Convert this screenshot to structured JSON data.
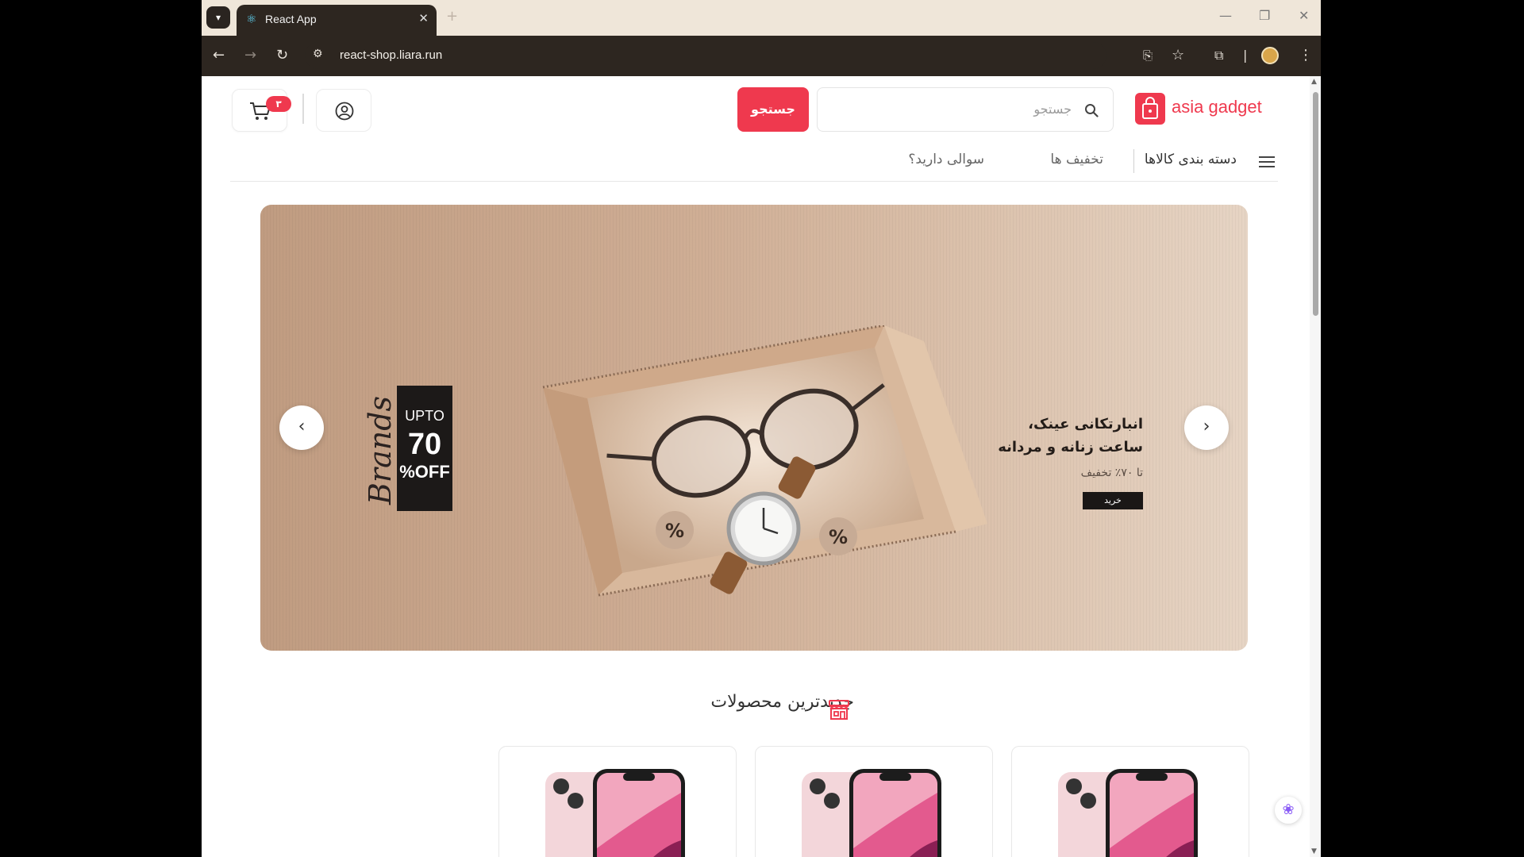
{
  "browser": {
    "tab_title": "React App",
    "tab_close": "✕",
    "tab_new": "+",
    "url": "react-shop.liara.run",
    "window_controls": [
      "—",
      "❐",
      "✕"
    ]
  },
  "header": {
    "cart_badge": "۳",
    "search_button": "جستجو",
    "search_placeholder": "جستجو",
    "logo_text": "asia gadget"
  },
  "nav": {
    "categories": "دسته بندی کالاها",
    "discounts": "تخفیف ها",
    "questions": "سوالی دارید؟"
  },
  "banner": {
    "title_line1": "انبارتکانی عینک،",
    "title_line2": "ساعت زنانه و مردانه",
    "subtitle": "تا ۷۰٪ تخفیف",
    "buy_button": "خرید",
    "brands_text": "Brands",
    "promo_upto": "UPTO",
    "promo_number": "70",
    "promo_off": "%OFF",
    "prev_arrow": "‹",
    "next_arrow": "›"
  },
  "section": {
    "title": "جدیدترین محصولات"
  },
  "products": [
    {
      "image": "pink-iphone"
    },
    {
      "image": "pink-iphone"
    },
    {
      "image": "pink-iphone"
    }
  ],
  "colors": {
    "accent": "#ef394e",
    "browser_dark": "#2d2620",
    "tabstrip": "#efe6d9"
  }
}
